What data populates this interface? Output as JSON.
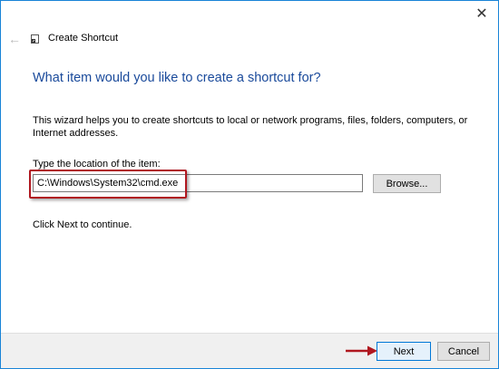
{
  "window": {
    "title": "Create Shortcut",
    "close_glyph": "✕",
    "back_glyph": "←"
  },
  "wizard": {
    "heading": "What item would you like to create a shortcut for?",
    "description": "This wizard helps you to create shortcuts to local or network programs, files, folders, computers, or Internet addresses.",
    "location_label": "Type the location of the item:",
    "location_value": "C:\\Windows\\System32\\cmd.exe",
    "browse_label": "Browse...",
    "continue_text": "Click Next to continue."
  },
  "footer": {
    "next_label": "Next",
    "cancel_label": "Cancel"
  },
  "icons": {
    "close": "close-icon",
    "back": "back-arrow-icon",
    "app": "shortcut-app-icon",
    "pointer": "red-pointer-arrow-icon"
  },
  "colors": {
    "heading": "#1a4a9b",
    "window_border": "#1883d7",
    "highlight": "#b0171f",
    "footer_bg": "#f0f0f0",
    "next_border": "#0078d7"
  }
}
